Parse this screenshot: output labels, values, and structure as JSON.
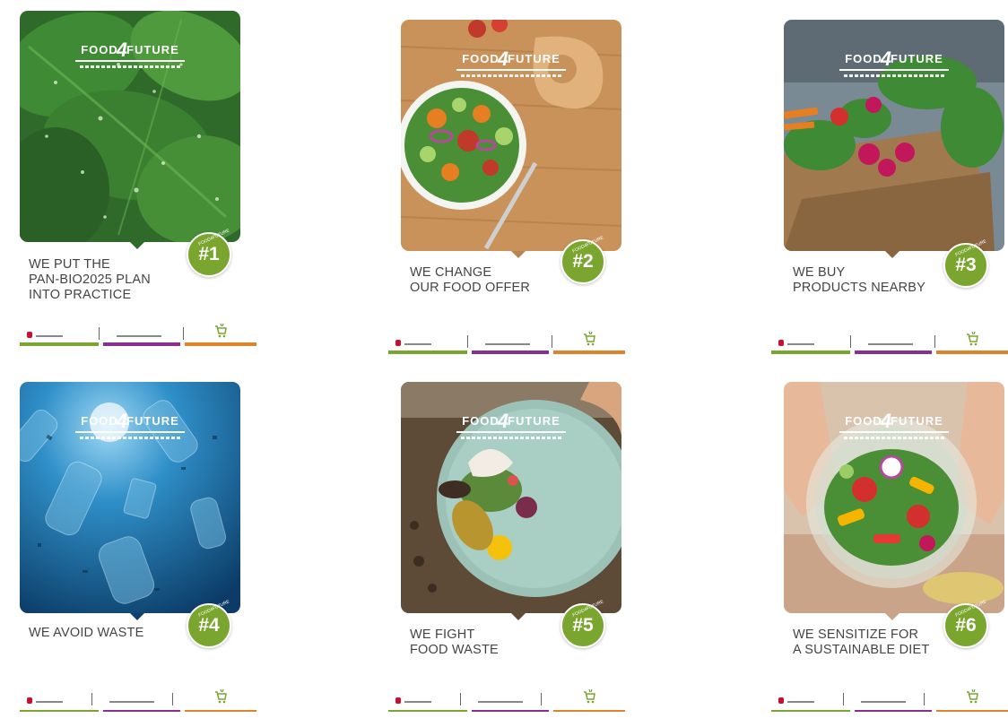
{
  "brand": {
    "logo_left": "FOOD",
    "logo_mid": "4",
    "logo_right": "FUTURE"
  },
  "colors": {
    "badge_green": "#7aa62f",
    "footer_green": "#7aa62f",
    "footer_purple": "#8a2f8f",
    "footer_orange": "#e0822a"
  },
  "posters": [
    {
      "badge": "#1",
      "caption_lines": [
        "WE PUT THE",
        "PAN-BIO2025 PLAN",
        "INTO PRACTICE"
      ],
      "photo": "spinach-leaves"
    },
    {
      "badge": "#2",
      "caption_lines": [
        "WE CHANGE",
        "OUR FOOD OFFER"
      ],
      "photo": "salad-bowl"
    },
    {
      "badge": "#3",
      "caption_lines": [
        "WE BUY",
        "PRODUCTS NEARBY"
      ],
      "photo": "vegetable-crate"
    },
    {
      "badge": "#4",
      "caption_lines": [
        "WE AVOID WASTE"
      ],
      "photo": "plastic-bottles-underwater"
    },
    {
      "badge": "#5",
      "caption_lines": [
        "WE FIGHT",
        "FOOD WASTE"
      ],
      "photo": "plate-leftovers"
    },
    {
      "badge": "#6",
      "caption_lines": [
        "WE SENSITIZE FOR",
        "A SUSTAINABLE DIET"
      ],
      "photo": "hands-holding-salad"
    }
  ]
}
